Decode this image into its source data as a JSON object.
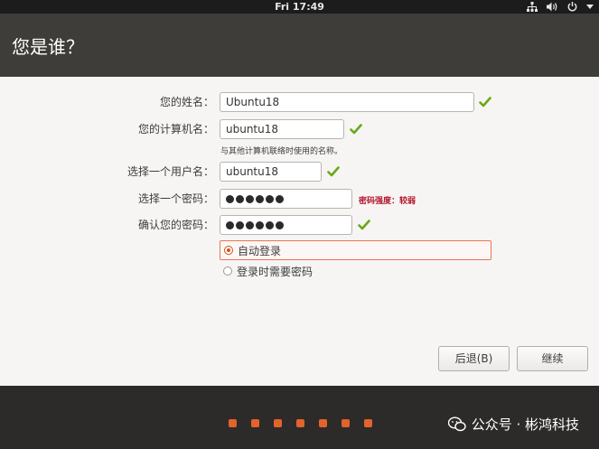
{
  "topbar": {
    "clock": "Fri 17:49",
    "icons": [
      "network-icon",
      "volume-icon",
      "power-icon",
      "menu-arrow-icon"
    ]
  },
  "header": {
    "title": "您是谁？"
  },
  "form": {
    "name": {
      "label": "您的姓名：",
      "value": "Ubuntu18",
      "valid": true
    },
    "computer_name": {
      "label": "您的计算机名：",
      "value": "ubuntu18",
      "valid": true,
      "hint": "与其他计算机联络时使用的名称。"
    },
    "username": {
      "label": "选择一个用户名：",
      "value": "ubuntu18",
      "valid": true
    },
    "password": {
      "label": "选择一个密码：",
      "value_masked": "●●●●●●",
      "strength": "密码强度：较弱",
      "strength_color": "#b3162a"
    },
    "confirm_password": {
      "label": "确认您的密码：",
      "value_masked": "●●●●●●",
      "valid": true
    }
  },
  "login_options": [
    {
      "label": "自动登录",
      "selected": true
    },
    {
      "label": "登录时需要密码",
      "selected": false
    }
  ],
  "buttons": {
    "back": "后退(B)",
    "continue": "继续"
  },
  "progress": {
    "steps_shown": 7,
    "color": "#e2632c"
  },
  "watermark": {
    "text": "公众号 · 彬鸿科技"
  },
  "colors": {
    "accent": "#e2632c",
    "check": "#6aa817",
    "header_bg": "#3f3d39"
  }
}
